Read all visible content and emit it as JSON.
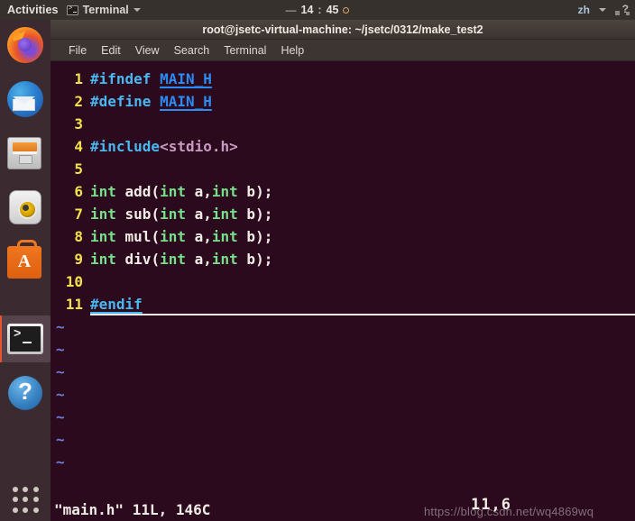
{
  "topbar": {
    "activities": "Activities",
    "app_name": "Terminal",
    "app_icon": "terminal-icon",
    "clock": {
      "dash": "—",
      "hours": "14",
      "separator": ":",
      "minutes": "45"
    },
    "input_method": "zh",
    "system_icon": "system-indicator-icon"
  },
  "dock": {
    "items": [
      {
        "name": "firefox",
        "label": "Firefox Web Browser",
        "icon": "firefox-icon",
        "active": false
      },
      {
        "name": "thunderbird",
        "label": "Thunderbird Mail",
        "icon": "thunderbird-icon",
        "active": false
      },
      {
        "name": "files",
        "label": "Files",
        "icon": "files-icon",
        "active": false
      },
      {
        "name": "rhythmbox",
        "label": "Rhythmbox",
        "icon": "rhythmbox-icon",
        "active": false
      },
      {
        "name": "software",
        "label": "Ubuntu Software",
        "icon": "ubuntu-software-icon",
        "active": false
      },
      {
        "name": "terminal",
        "label": "Terminal",
        "icon": "terminal-icon",
        "active": true
      },
      {
        "name": "help",
        "label": "Help",
        "icon": "help-icon",
        "active": false
      }
    ],
    "show_applications_label": "Show Applications"
  },
  "window": {
    "title": "root@jsetc-virtual-machine: ~/jsetc/0312/make_test2",
    "menu": [
      "File",
      "Edit",
      "View",
      "Search",
      "Terminal",
      "Help"
    ]
  },
  "editor": {
    "lines": [
      {
        "n": "1",
        "tokens": [
          {
            "t": "#ifndef ",
            "c": "t-pre"
          },
          {
            "t": "MAIN_H",
            "c": "t-macro u-underline"
          }
        ]
      },
      {
        "n": "2",
        "tokens": [
          {
            "t": "#define ",
            "c": "t-pre"
          },
          {
            "t": "MAIN_H",
            "c": "t-macro u-underline"
          }
        ]
      },
      {
        "n": "3",
        "tokens": []
      },
      {
        "n": "4",
        "tokens": [
          {
            "t": "#include",
            "c": "t-pre"
          },
          {
            "t": "<stdio.h>",
            "c": "t-str"
          }
        ]
      },
      {
        "n": "5",
        "tokens": []
      },
      {
        "n": "6",
        "tokens": [
          {
            "t": "int",
            "c": "t-kw"
          },
          {
            "t": " add(",
            "c": "t-id"
          },
          {
            "t": "int",
            "c": "t-kw"
          },
          {
            "t": " a,",
            "c": "t-id"
          },
          {
            "t": "int",
            "c": "t-kw"
          },
          {
            "t": " b);",
            "c": "t-id"
          }
        ]
      },
      {
        "n": "7",
        "tokens": [
          {
            "t": "int",
            "c": "t-kw"
          },
          {
            "t": " sub(",
            "c": "t-id"
          },
          {
            "t": "int",
            "c": "t-kw"
          },
          {
            "t": " a,",
            "c": "t-id"
          },
          {
            "t": "int",
            "c": "t-kw"
          },
          {
            "t": " b);",
            "c": "t-id"
          }
        ]
      },
      {
        "n": "8",
        "tokens": [
          {
            "t": "int",
            "c": "t-kw"
          },
          {
            "t": " mul(",
            "c": "t-id"
          },
          {
            "t": "int",
            "c": "t-kw"
          },
          {
            "t": " a,",
            "c": "t-id"
          },
          {
            "t": "int",
            "c": "t-kw"
          },
          {
            "t": " b);",
            "c": "t-id"
          }
        ]
      },
      {
        "n": "9",
        "tokens": [
          {
            "t": "int",
            "c": "t-kw"
          },
          {
            "t": " div(",
            "c": "t-id"
          },
          {
            "t": "int",
            "c": "t-kw"
          },
          {
            "t": " a,",
            "c": "t-id"
          },
          {
            "t": "int",
            "c": "t-kw"
          },
          {
            "t": " b);",
            "c": "t-id"
          }
        ]
      },
      {
        "n": "10",
        "tokens": []
      },
      {
        "n": "11",
        "tokens": [
          {
            "t": "#endif",
            "c": "t-pre u-underline"
          }
        ],
        "cursorline": true
      }
    ],
    "tilde_count": 7,
    "tilde_char": "~"
  },
  "statusline": {
    "file_info": "\"main.h\" 11L, 146C",
    "cursor_position": "11,6"
  },
  "watermark": "https://blog.csdn.net/wq4869wq"
}
